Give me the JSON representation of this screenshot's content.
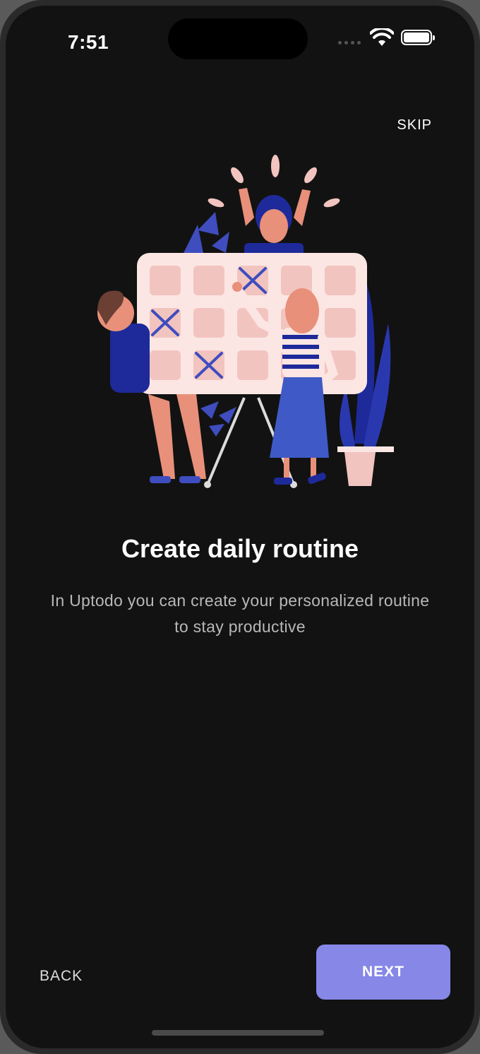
{
  "status_bar": {
    "time": "7:51"
  },
  "header": {
    "skip_label": "SKIP"
  },
  "onboarding": {
    "title": "Create daily routine",
    "description": "In Uptodo you can create your personalized routine to stay productive"
  },
  "footer": {
    "back_label": "BACK",
    "next_label": "NEXT"
  },
  "colors": {
    "background": "#121212",
    "accent": "#8687E7",
    "illustration_pink": "#F2C4C0",
    "illustration_blue": "#3F4DBE"
  },
  "icons": [
    "wifi-icon",
    "battery-icon",
    "signal-icon"
  ]
}
